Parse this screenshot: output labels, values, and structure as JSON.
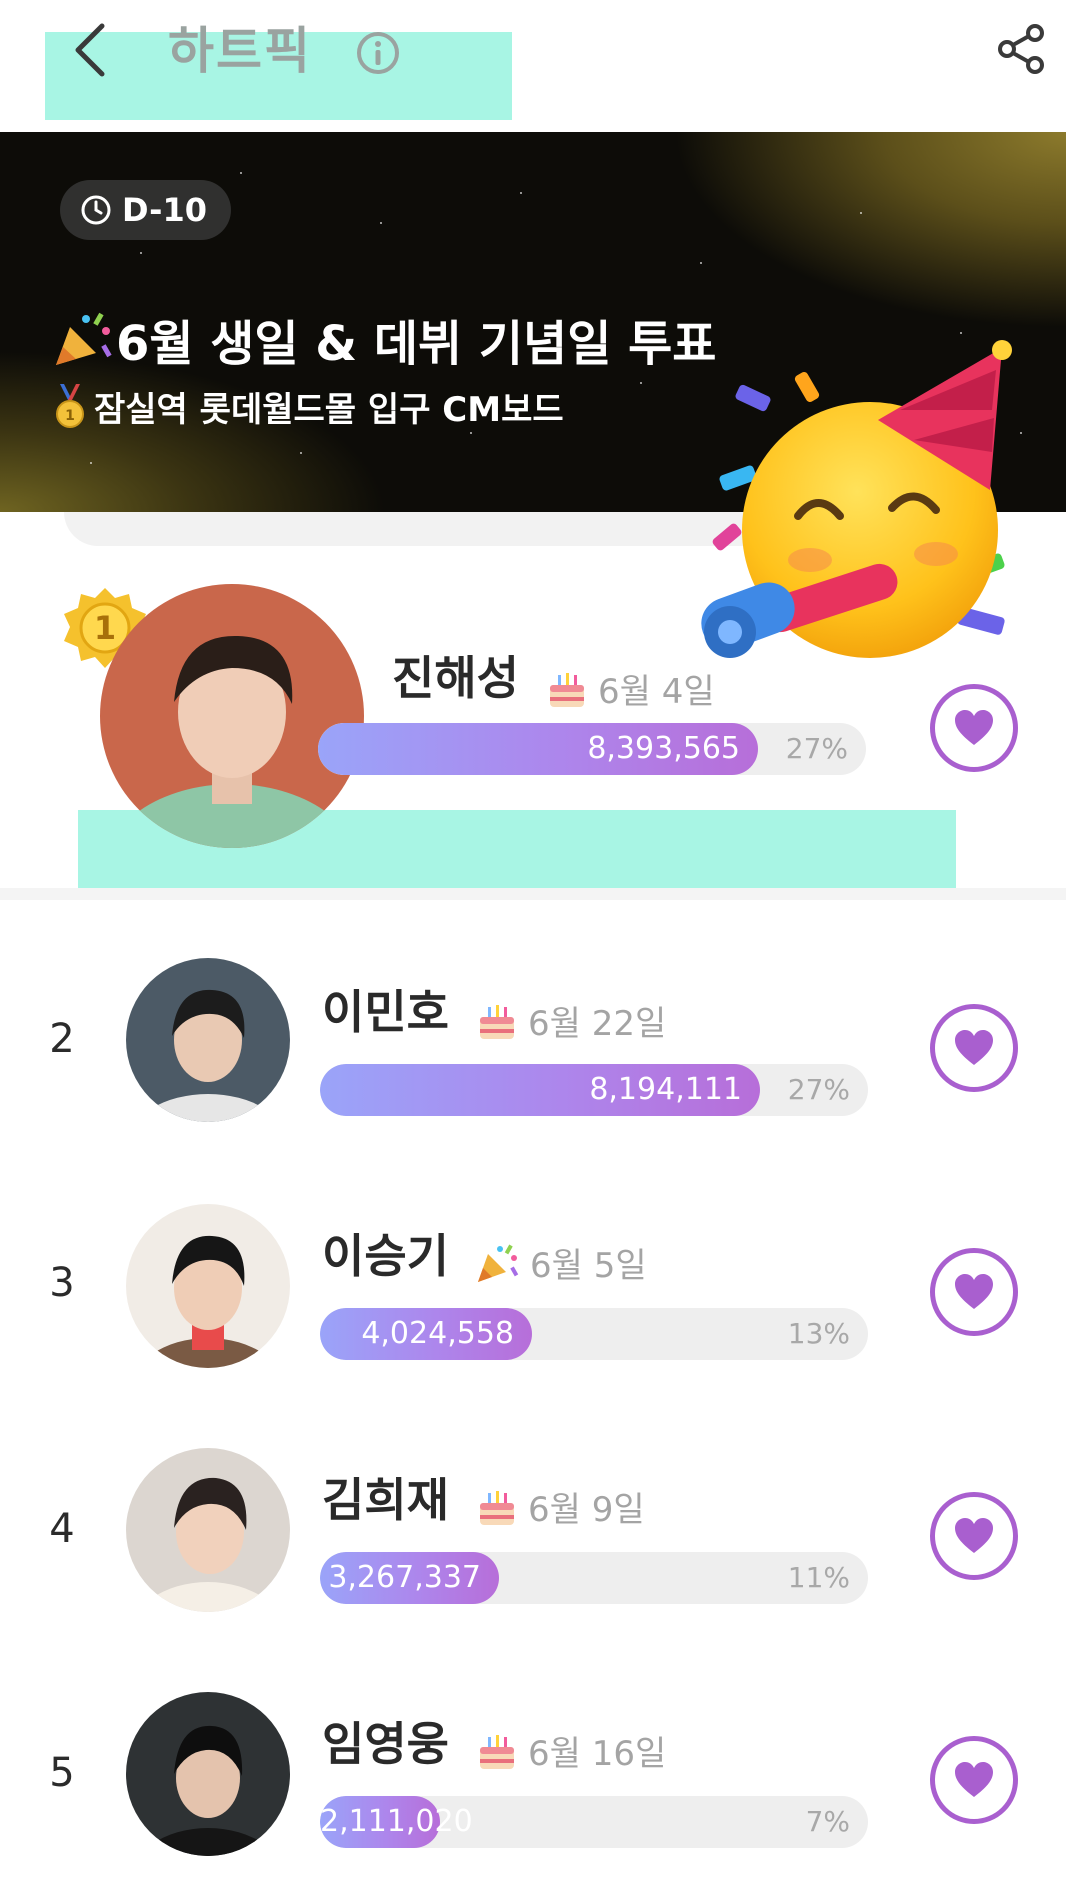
{
  "header": {
    "title": "하트픽",
    "back_icon": "chevron-left-icon",
    "info_icon": "info-icon",
    "share_icon": "share-icon"
  },
  "banner": {
    "dday": "D-10",
    "title": "6월 생일 & 데뷔 기념일 투표",
    "subtitle": "잠실역 롯데월드몰 입구 CM보드",
    "title_icon": "party-popper-icon",
    "subtitle_icon": "medal-icon",
    "decoration_icon": "partying-face-emoji"
  },
  "colors": {
    "accent": "#a95fcf",
    "bar_start": "#9aa4f9",
    "bar_end": "#b76ed9",
    "highlight": "#8ff2dd"
  },
  "ranking": [
    {
      "rank": "1",
      "name": "진해성",
      "date": "6월 4일",
      "date_icon": "birthday-cake-icon",
      "votes": "8,393,565",
      "percent": "27%",
      "share": 0.27
    },
    {
      "rank": "2",
      "name": "이민호",
      "date": "6월 22일",
      "date_icon": "birthday-cake-icon",
      "votes": "8,194,111",
      "percent": "27%",
      "share": 0.27
    },
    {
      "rank": "3",
      "name": "이승기",
      "date": "6월 5일",
      "date_icon": "party-popper-icon",
      "votes": "4,024,558",
      "percent": "13%",
      "share": 0.13
    },
    {
      "rank": "4",
      "name": "김희재",
      "date": "6월 9일",
      "date_icon": "birthday-cake-icon",
      "votes": "3,267,337",
      "percent": "11%",
      "share": 0.11
    },
    {
      "rank": "5",
      "name": "임영웅",
      "date": "6월 16일",
      "date_icon": "birthday-cake-icon",
      "votes": "2,111,020",
      "percent": "7%",
      "share": 0.07
    }
  ]
}
